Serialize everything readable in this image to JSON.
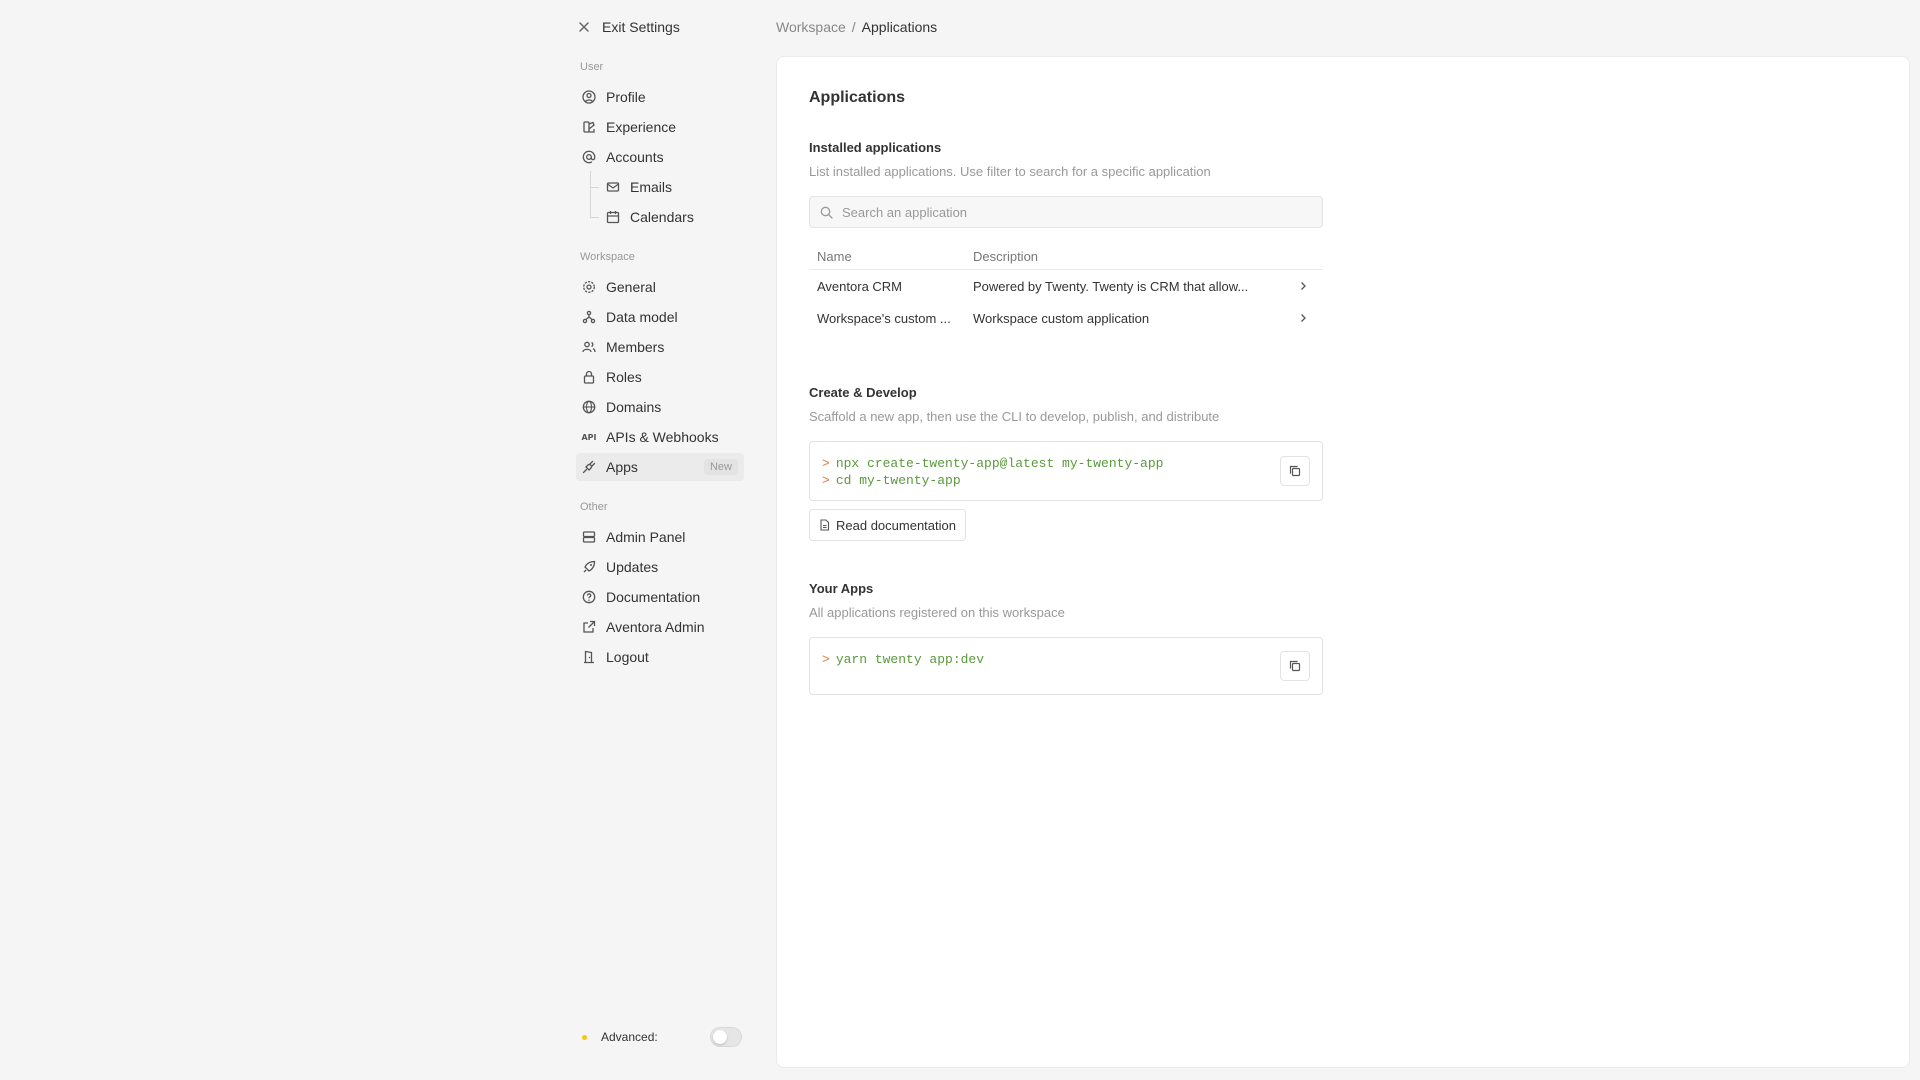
{
  "sidebar": {
    "exit_label": "Exit Settings",
    "user_section": "User",
    "user_items": [
      {
        "label": "Profile",
        "icon": "user-circle-icon"
      },
      {
        "label": "Experience",
        "icon": "palette-icon"
      },
      {
        "label": "Accounts",
        "icon": "at-icon"
      }
    ],
    "account_sub_items": [
      {
        "label": "Emails",
        "icon": "mail-icon"
      },
      {
        "label": "Calendars",
        "icon": "calendar-icon"
      }
    ],
    "workspace_section": "Workspace",
    "workspace_items": [
      {
        "label": "General",
        "icon": "gear-icon"
      },
      {
        "label": "Data model",
        "icon": "hierarchy-icon"
      },
      {
        "label": "Members",
        "icon": "users-icon"
      },
      {
        "label": "Roles",
        "icon": "lock-icon"
      },
      {
        "label": "Domains",
        "icon": "globe-icon"
      },
      {
        "label": "APIs & Webhooks",
        "icon": "api-icon"
      },
      {
        "label": "Apps",
        "icon": "plug-icon",
        "badge": "New",
        "active": true
      }
    ],
    "other_section": "Other",
    "other_items": [
      {
        "label": "Admin Panel",
        "icon": "server-icon"
      },
      {
        "label": "Updates",
        "icon": "rocket-icon"
      },
      {
        "label": "Documentation",
        "icon": "help-circle-icon"
      },
      {
        "label": "Aventora Admin",
        "icon": "external-link-icon"
      },
      {
        "label": "Logout",
        "icon": "door-exit-icon"
      }
    ],
    "advanced_label": "Advanced:",
    "advanced_enabled": false
  },
  "breadcrumb": {
    "parent": "Workspace",
    "separator": "/",
    "current": "Applications"
  },
  "main": {
    "title": "Applications",
    "installed": {
      "title": "Installed applications",
      "description": "List installed applications. Use filter to search for a specific application",
      "search_placeholder": "Search an application",
      "columns": [
        "Name",
        "Description"
      ],
      "rows": [
        {
          "name": "Aventora CRM",
          "description": "Powered by Twenty. Twenty is CRM that allow..."
        },
        {
          "name": "Workspace's custom ...",
          "description": "Workspace custom application"
        }
      ]
    },
    "create": {
      "title": "Create & Develop",
      "description": "Scaffold a new app, then use the CLI to develop, publish, and distribute",
      "prompt": ">",
      "commands": [
        "npx create-twenty-app@latest my-twenty-app",
        "cd my-twenty-app"
      ],
      "doc_button": "Read documentation"
    },
    "your_apps": {
      "title": "Your Apps",
      "description": "All applications registered on this workspace",
      "prompt": ">",
      "commands": [
        "yarn twenty app:dev"
      ]
    }
  },
  "colors": {
    "background": "#f5f5f5",
    "panel": "#ffffff",
    "code_green": "#5a9a3c",
    "prompt_orange": "#e07b3c",
    "advanced_dot": "#f5c518"
  }
}
